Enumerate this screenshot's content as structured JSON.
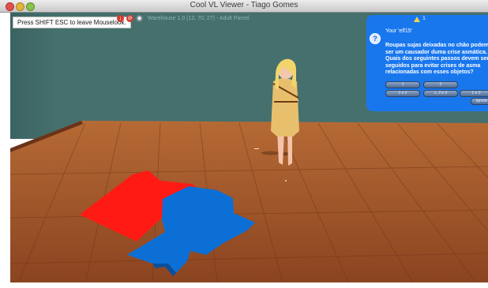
{
  "window": {
    "title": "Cool VL Viewer - Tiago Gomes"
  },
  "overlay": {
    "mouselook_hint": "Press SHIFT ESC to leave Mouselook.",
    "location_text": "Warehouse 1.0 (12, 70, 27) - Adult Parcel"
  },
  "dialog": {
    "notice_count": "1",
    "sender": "Your 'elf15'",
    "message": "Roupas sujas deixadas no chão podem ser um causador duma crise asmática. Quais dos seguintes passos devem ser seguidos para evitar crises de asma relacionadas com esses objetos?",
    "buttons": [
      "1",
      "2",
      "1 e 2",
      "1, 2 e 3",
      "1 e 3",
      "Ignore"
    ]
  },
  "icons": {
    "dialog": "question-icon",
    "notice": "warning-icon"
  },
  "colors": {
    "wall": "#45706d",
    "floor": "#a85a2c",
    "dialog_bg": "#1977ee",
    "red_shirt": "#ff1b13",
    "blue_shirt": "#0c6fd6"
  }
}
